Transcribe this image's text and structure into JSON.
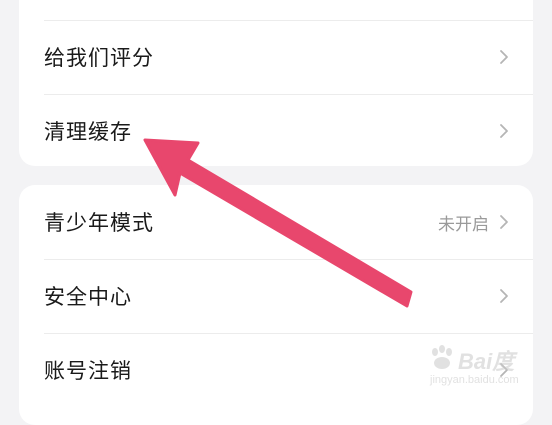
{
  "settings": {
    "group1": {
      "items": [
        {
          "label": "给我们评分",
          "value": ""
        },
        {
          "label": "清理缓存",
          "value": ""
        }
      ]
    },
    "group2": {
      "items": [
        {
          "label": "青少年模式",
          "value": "未开启"
        },
        {
          "label": "安全中心",
          "value": ""
        },
        {
          "label": "账号注销",
          "value": ""
        }
      ]
    }
  },
  "annotation": {
    "arrow_color": "#e8476d",
    "points_to": "清理缓存"
  },
  "watermark": {
    "brand": "Bai度",
    "url": "jingyan.baidu.com"
  },
  "icons": {
    "row_chevron": "chevron-right-icon",
    "watermark_logo": "baidu-paw-icon"
  }
}
